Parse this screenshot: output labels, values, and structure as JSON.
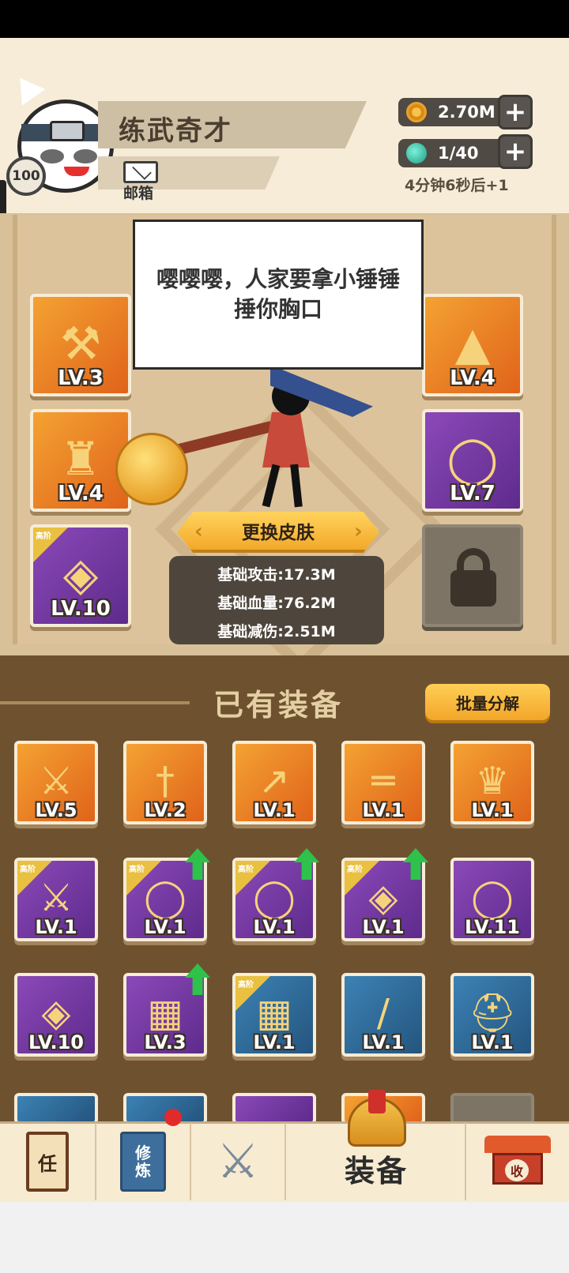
{
  "player": {
    "name": "练武奇才",
    "level": "100",
    "mail_label": "邮箱"
  },
  "resources": {
    "coins": "2.70M",
    "energy": "1/40",
    "regen_text": "4分钟6秒后+1"
  },
  "speech": "嘤嘤嘤，人家要拿小锤锤捶你胸口",
  "equipped": {
    "left": [
      {
        "lv": "LV.3",
        "color": "orange",
        "icon": "golden-hammer-icon",
        "glyph": "⚒"
      },
      {
        "lv": "LV.4",
        "color": "orange",
        "icon": "red-armor-icon",
        "glyph": "♜"
      },
      {
        "lv": "LV.10",
        "color": "purple",
        "icon": "pendant-icon",
        "glyph": "◈",
        "tier": "高阶"
      }
    ],
    "right": [
      {
        "lv": "LV.4",
        "color": "orange",
        "icon": "straw-hat-icon",
        "glyph": "▲"
      },
      {
        "lv": "LV.7",
        "color": "purple",
        "icon": "green-ring-icon",
        "glyph": "◯"
      }
    ]
  },
  "skin_button": "更换皮肤",
  "stats": {
    "attack": "基础攻击:17.3M",
    "hp": "基础血量:76.2M",
    "defense": "基础减伤:2.51M"
  },
  "inventory": {
    "title": "已有装备",
    "batch_button": "批量分解",
    "items": [
      {
        "lv": "LV.5",
        "color": "orange",
        "icon": "golden-sword-icon",
        "glyph": "⚔"
      },
      {
        "lv": "LV.2",
        "color": "orange",
        "icon": "silver-sword-icon",
        "glyph": "†"
      },
      {
        "lv": "LV.1",
        "color": "orange",
        "icon": "spear-icon",
        "glyph": "↗"
      },
      {
        "lv": "LV.1",
        "color": "orange",
        "icon": "rifle-icon",
        "glyph": "═"
      },
      {
        "lv": "LV.1",
        "color": "orange",
        "icon": "blue-robe-icon",
        "glyph": "♛"
      },
      {
        "lv": "LV.1",
        "color": "purple",
        "icon": "machete-icon",
        "glyph": "⚔",
        "tier": "高阶"
      },
      {
        "lv": "LV.1",
        "color": "purple",
        "icon": "gold-ring-icon",
        "glyph": "◯",
        "tier": "高阶",
        "upgrade": true
      },
      {
        "lv": "LV.1",
        "color": "purple",
        "icon": "sapphire-ring-icon",
        "glyph": "◯",
        "tier": "高阶",
        "upgrade": true
      },
      {
        "lv": "LV.1",
        "color": "purple",
        "icon": "pendant-icon",
        "glyph": "◈",
        "tier": "高阶",
        "upgrade": true
      },
      {
        "lv": "LV.11",
        "color": "purple",
        "icon": "gold-ring-icon",
        "glyph": "◯"
      },
      {
        "lv": "LV.10",
        "color": "purple",
        "icon": "bronze-pendant-icon",
        "glyph": "◈"
      },
      {
        "lv": "LV.3",
        "color": "purple",
        "icon": "jade-bracer-icon",
        "glyph": "▦",
        "upgrade": true
      },
      {
        "lv": "LV.1",
        "color": "blue",
        "icon": "jade-bracer-icon",
        "glyph": "▦",
        "tier": "高阶"
      },
      {
        "lv": "LV.1",
        "color": "blue",
        "icon": "wooden-sword-icon",
        "glyph": "/"
      },
      {
        "lv": "LV.1",
        "color": "blue",
        "icon": "golden-helmet-icon",
        "glyph": "⛑"
      }
    ]
  },
  "nav": {
    "tasks_glyph": "任",
    "cultivate_line1": "修",
    "cultivate_line2": "炼",
    "equipment_label": "装备",
    "shop_glyph": "收"
  },
  "colors": {
    "orange_slot": "#e9801f",
    "purple_slot": "#6e3698",
    "blue_slot": "#2f6a9a",
    "upgrade_green": "#2ec24a",
    "accent_gold": "#f6b83a"
  }
}
